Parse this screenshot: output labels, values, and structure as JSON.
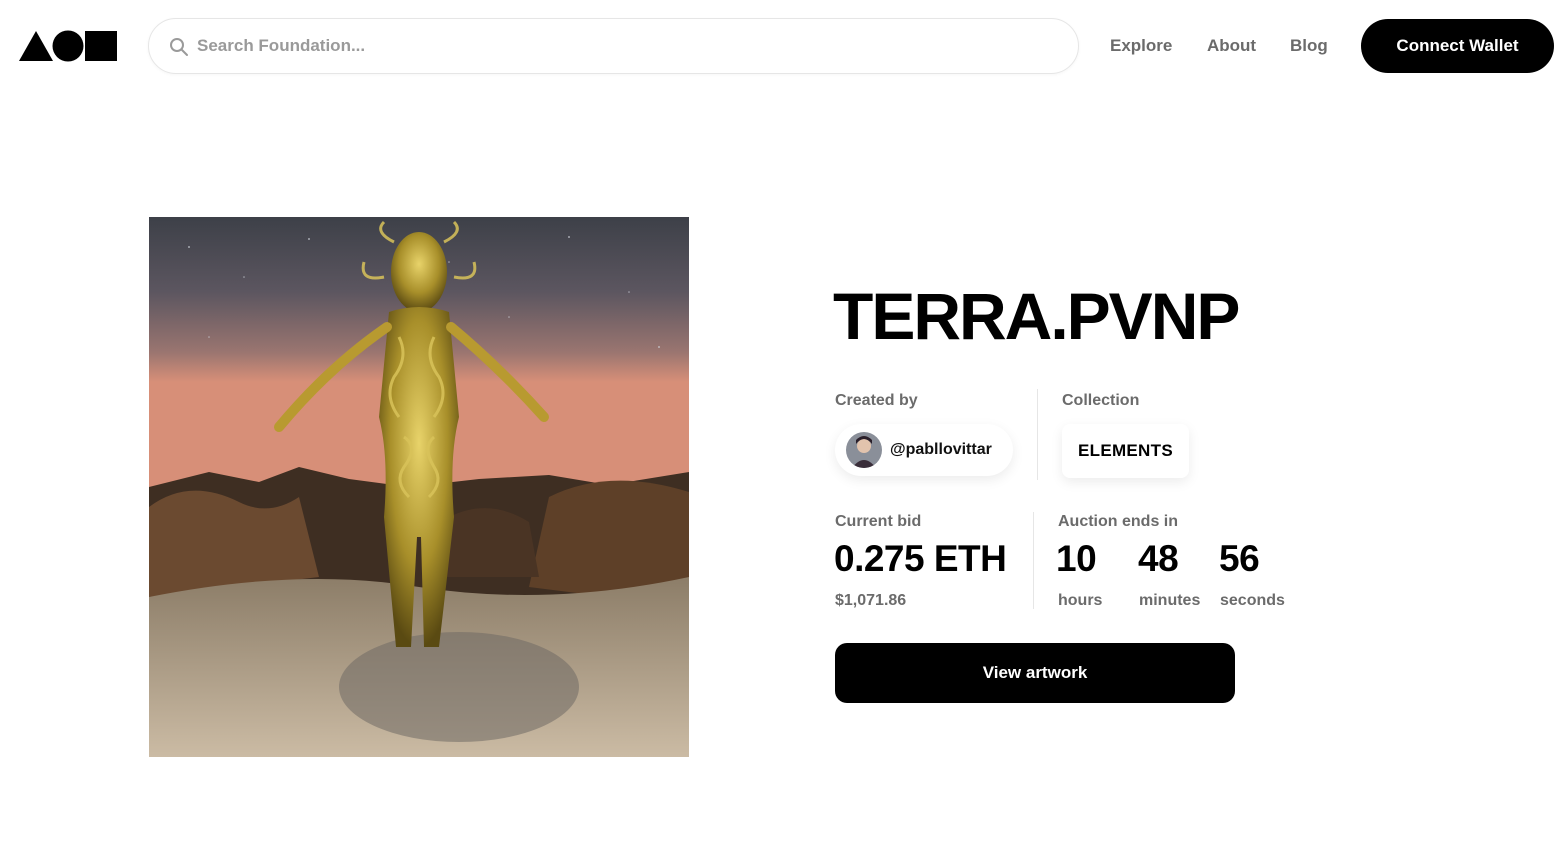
{
  "header": {
    "search_placeholder": "Search Foundation...",
    "nav": [
      "Explore",
      "About",
      "Blog"
    ],
    "connect_label": "Connect Wallet"
  },
  "artwork": {
    "title": "TERRA.PVNP",
    "created_by_label": "Created by",
    "creator": "@pabllovittar",
    "collection_label": "Collection",
    "collection": "ELEMENTS",
    "current_bid_label": "Current bid",
    "current_bid": "0.275 ETH",
    "current_bid_usd": "$1,071.86",
    "auction_label": "Auction ends in",
    "countdown": [
      {
        "value": "10",
        "unit": "hours"
      },
      {
        "value": "48",
        "unit": "minutes"
      },
      {
        "value": "56",
        "unit": "seconds"
      }
    ],
    "view_label": "View artwork"
  },
  "colors": {
    "accent": "#000000",
    "muted_text": "#6b6b6b",
    "border": "#e6e6e6"
  }
}
